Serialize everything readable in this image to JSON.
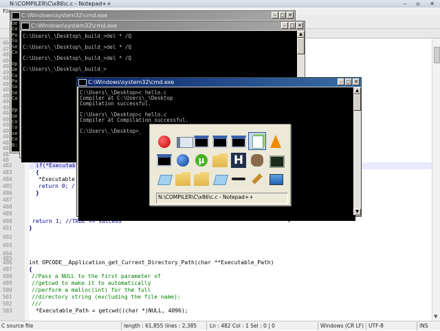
{
  "notepadpp": {
    "title": "N:\\COMPILER\\C\\x86\\c.c - Notepad++",
    "menu_file": "File",
    "gutter_top": [
      "46",
      "47",
      "48",
      "49",
      "49",
      "49",
      "49",
      "49",
      "49",
      "49",
      "49",
      "49",
      "49",
      "49",
      "49",
      "49",
      "49",
      "48",
      "48",
      "48",
      "48"
    ],
    "lines": [
      {
        "num": "482",
        "code": "if(*Executabl"
      },
      {
        "num": "483",
        "code": "{"
      },
      {
        "num": "484",
        "code": "*Executable"
      },
      {
        "num": "485",
        "code": "return 0; /"
      },
      {
        "num": "486",
        "code": "}"
      },
      {
        "num": "487",
        "code": ""
      },
      {
        "num": "488",
        "code": ""
      },
      {
        "num": "489",
        "code": ""
      },
      {
        "num": "490",
        "code": "return 1; //TRUE == success"
      },
      {
        "num": "491",
        "code": "}"
      },
      {
        "num": "492",
        "code": ""
      },
      {
        "num": "493",
        "code": ""
      },
      {
        "num": "494",
        "code": ""
      },
      {
        "num": "495",
        "code": ""
      },
      {
        "num": "496",
        "code": "int OPCODE__Application_get_Current_Directory_Path(char **Executable_Path)"
      },
      {
        "num": "497",
        "code": "{"
      },
      {
        "num": "498",
        "code": "//Pass a NULL to the first parameter of"
      },
      {
        "num": "499",
        "code": "//getcwd to make it to automatically"
      },
      {
        "num": "500",
        "code": "//perform a malloc(int) for the full"
      },
      {
        "num": "501",
        "code": "//directory string (excluding the file name):"
      },
      {
        "num": "502",
        "code": "///"
      },
      {
        "num": "503",
        "code": "*Executable_Path = getcwd((char *)NULL, 4096);"
      }
    ],
    "status": {
      "type": "C source file",
      "length": "length : 61,855",
      "lines": "lines : 2,385",
      "position": "Ln : 482   Col : 1   Sel : 0 | 0",
      "eol": "Windows (CR LF)",
      "encoding": "UTF-8",
      "mode": "INS"
    }
  },
  "cmd_back": {
    "title": "C:\\Windows\\system32\\cmd.exe",
    "console_left": [
      "Ue",
      "Co",
      "Po",
      "Su",
      "Se",
      "Co",
      "",
      "Op",
      "Ue",
      "Co",
      "Po",
      "So",
      "Se",
      "Co",
      "",
      "Op",
      "Ue",
      "Co",
      "lo",
      "se",
      "Co",
      "N:"
    ]
  },
  "cmd_mid": {
    "title": "C:\\Windows\\system32\\cmd.exe",
    "lines": [
      "C:\\Users\\_\\Desktop\\_build_>del * /Q",
      "",
      "C:\\Users\\_\\Desktop\\_build_>del * /Q",
      "",
      "C:\\Users\\_\\Desktop\\_build_>del * /Q",
      "",
      "C:\\Users\\_\\Desktop\\_build_>"
    ]
  },
  "cmd_front": {
    "title": "C:\\Windows\\system32\\cmd.exe",
    "lines": [
      "C:\\Users\\_\\Desktop>c hello.c",
      "Compiler at C:\\Users\\_\\Desktop",
      "Compilation successful.",
      "",
      "C:\\Users\\_\\Desktop>c hello.c",
      "Compiler at Compilation successful.",
      "",
      "C:\\Users\\_\\Desktop>_"
    ]
  },
  "alttab": {
    "selected_caption": "N:\\COMPILER\\C\\x86\\c.c - Notepad++",
    "icons": [
      "record-icon",
      "window-icon",
      "cmd-icon",
      "cmd-icon",
      "cmd-icon",
      "notepadpp-icon",
      "vlc-cone-icon",
      "cmd-icon",
      "globe-icon",
      "utorrent-icon",
      "folder-icon",
      "hex-editor-icon",
      "gimp-icon",
      "terminal-icon",
      "note-icon",
      "folder-icon",
      "folder-icon",
      "note-icon",
      "line-icon",
      "tools-icon",
      "monitor-icon"
    ]
  },
  "colors": {
    "title_active": "#0a246a",
    "title_inactive": "#7a7a7a",
    "console_bg": "#000000",
    "console_fg": "#c0c0c0",
    "comment": "#008000",
    "keyword": "#00008b",
    "type": "#8000ff",
    "number": "#ff8000"
  }
}
